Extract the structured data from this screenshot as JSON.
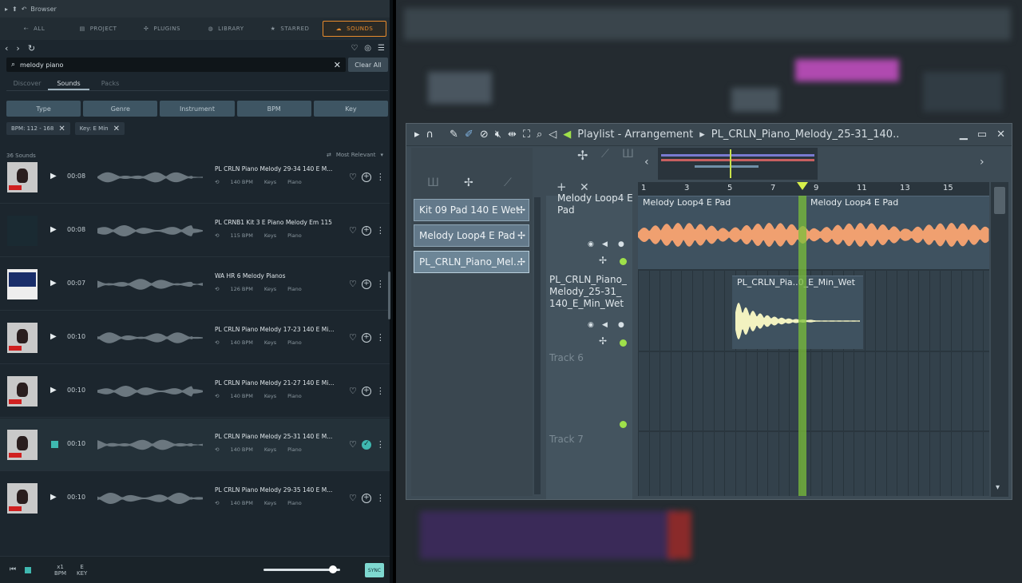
{
  "browser": {
    "title": "Browser",
    "tabs": [
      {
        "label": "ALL",
        "icon": "all-icon"
      },
      {
        "label": "PROJECT",
        "icon": "project-icon"
      },
      {
        "label": "PLUGINS",
        "icon": "plugins-icon"
      },
      {
        "label": "LIBRARY",
        "icon": "library-icon"
      },
      {
        "label": "STARRED",
        "icon": "star-icon"
      },
      {
        "label": "SOUNDS",
        "icon": "cloud-icon",
        "active": true
      }
    ],
    "search": {
      "value": "melody piano",
      "placeholder": ""
    },
    "clear_all": "Clear All",
    "subtabs": [
      "Discover",
      "Sounds",
      "Packs"
    ],
    "filters": [
      "Type",
      "Genre",
      "Instrument",
      "BPM",
      "Key"
    ],
    "chips": [
      "BPM: 112 - 168",
      "Key: E Min"
    ],
    "count": "36 Sounds",
    "sort": "Most Relevant",
    "sounds": [
      {
        "duration": "00:08",
        "title": "PL CRLN Piano Melody 29-34 140 E M...",
        "bpm": "140 BPM",
        "cat": "Keys",
        "inst": "Piano",
        "thumb": "crln"
      },
      {
        "duration": "00:08",
        "title": "PL CRNB1 Kit 3 E Piano Melody Em 115",
        "bpm": "115 BPM",
        "cat": "Keys",
        "inst": "Piano",
        "thumb": "dark"
      },
      {
        "duration": "00:07",
        "title": "WA HR 6 Melody Pianos",
        "bpm": "126 BPM",
        "cat": "Keys",
        "inst": "Piano",
        "thumb": "house"
      },
      {
        "duration": "00:10",
        "title": "PL CRLN Piano Melody 17-23 140 E Mi...",
        "bpm": "140 BPM",
        "cat": "Keys",
        "inst": "Piano",
        "thumb": "crln"
      },
      {
        "duration": "00:10",
        "title": "PL CRLN Piano Melody 21-27 140 E Mi...",
        "bpm": "140 BPM",
        "cat": "Keys",
        "inst": "Piano",
        "thumb": "crln"
      },
      {
        "duration": "00:10",
        "title": "PL CRLN Piano Melody 25-31 140 E M...",
        "bpm": "140 BPM",
        "cat": "Keys",
        "inst": "Piano",
        "thumb": "crln",
        "selected": true
      },
      {
        "duration": "00:10",
        "title": "PL CRLN Piano Melody 29-35 140 E M...",
        "bpm": "140 BPM",
        "cat": "Keys",
        "inst": "Piano",
        "thumb": "crln"
      }
    ],
    "bottom": {
      "bpm_label": "BPM",
      "bpm_mult": "x1",
      "key_label": "KEY",
      "key_val": "E",
      "sync": "SYNC"
    }
  },
  "playlist": {
    "title": "Playlist - Arrangement",
    "pattern_name": "PL_CRLN_Piano_Melody_25-31_140..",
    "patterns": [
      "Kit 09 Pad 140 E Wet",
      "Melody Loop4 E Pad",
      "PL_CRLN_Piano_Mel.."
    ],
    "tracks": [
      {
        "name": "Melody Loop4 E Pad"
      },
      {
        "name": "PL_CRLN_Piano_ Melody_25-31_ 140_E_Min_Wet"
      },
      {
        "name": "Track 6"
      },
      {
        "name": "Track 7"
      }
    ],
    "ruler": [
      "1",
      "3",
      "5",
      "7",
      "9",
      "11",
      "13",
      "15"
    ],
    "clips": {
      "loop_a": "Melody Loop4 E Pad",
      "loop_b": "Melody Loop4 E Pad",
      "piano": "PL_CRLN_Pia..0_E_Min_Wet"
    },
    "colors": {
      "loop_wave": "#f0a070",
      "piano_wave": "#f2f2c0",
      "playhead": "#7bbf3a",
      "accent": "#e88b2c"
    }
  }
}
